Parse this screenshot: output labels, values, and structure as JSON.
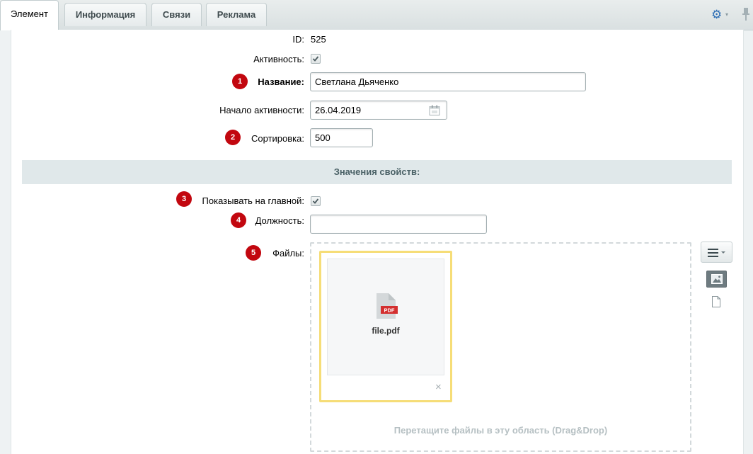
{
  "tabs": [
    {
      "label": "Элемент",
      "active": true
    },
    {
      "label": "Информация",
      "active": false
    },
    {
      "label": "Связи",
      "active": false
    },
    {
      "label": "Реклама",
      "active": false
    }
  ],
  "toolbar": {
    "settings_icon": "gear-icon",
    "settings_caret": "▾",
    "pin_icon": "pin-icon"
  },
  "form": {
    "id": {
      "label": "ID:",
      "value": "525"
    },
    "active": {
      "label": "Активность:",
      "checked": true
    },
    "name": {
      "badge": "1",
      "label": "Название:",
      "value": "Светлана Дьяченко"
    },
    "start_date": {
      "label": "Начало активности:",
      "value": "26.04.2019",
      "icon": "calendar-icon"
    },
    "sort": {
      "badge": "2",
      "label": "Сортировка:",
      "value": "500"
    },
    "section_title": "Значения свойств:",
    "show_on_main": {
      "badge": "3",
      "label": "Показывать на главной:",
      "checked": true
    },
    "position": {
      "badge": "4",
      "label": "Должность:",
      "value": ""
    },
    "files": {
      "badge": "5",
      "label": "Файлы:",
      "items": [
        {
          "name": "file.pdf",
          "type_badge": "PDF",
          "icon": "pdf-file-icon"
        }
      ],
      "remove_icon": "×",
      "drop_hint": "Перетащите файлы в эту область (Drag&Drop)"
    }
  },
  "colors": {
    "badge": "#c2070f",
    "accent": "#2f6fb5",
    "file_highlight": "#f6dd77",
    "section_bg": "#e0e8ea"
  }
}
